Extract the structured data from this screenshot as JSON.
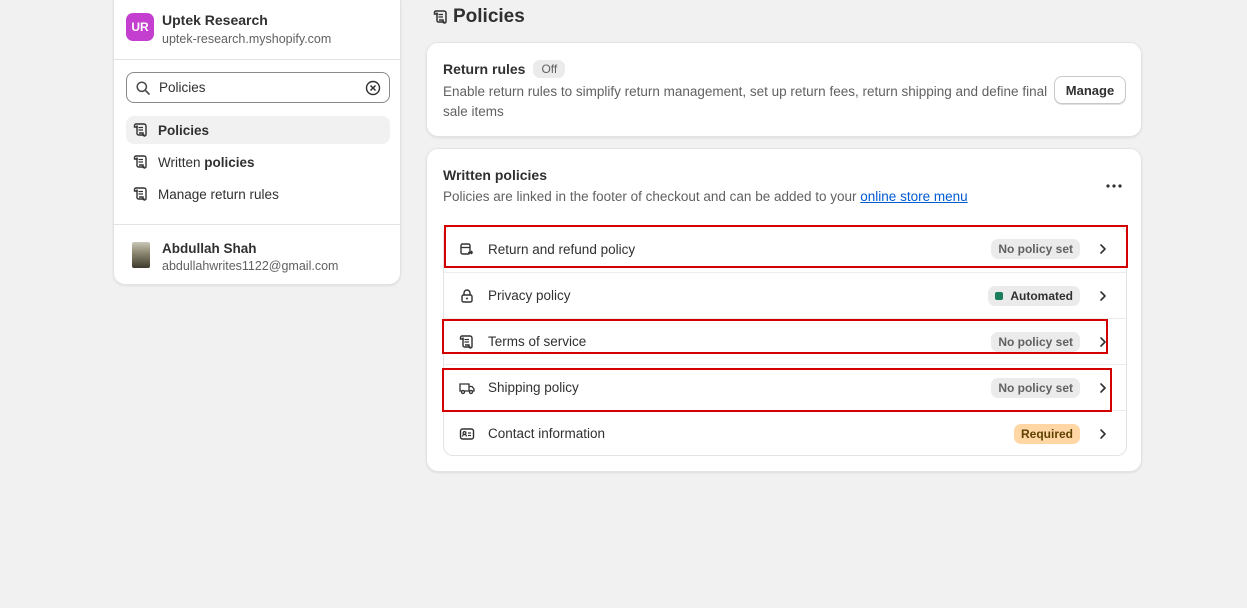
{
  "sidebar": {
    "store": {
      "initials": "UR",
      "name": "Uptek Research",
      "url": "uptek-research.myshopify.com",
      "avatar_color": "#c43ed0"
    },
    "search": {
      "value": "Policies",
      "placeholder": "Search"
    },
    "results": [
      {
        "label": "Policies",
        "active": true
      },
      {
        "label_plain": "Written ",
        "label_bold": "policies"
      },
      {
        "label": "Manage return rules"
      }
    ],
    "user": {
      "name": "Abdullah Shah",
      "email": "abdullahwrites1122@gmail.com"
    }
  },
  "page": {
    "title": "Policies"
  },
  "return_rules": {
    "title": "Return rules",
    "status": "Off",
    "description": "Enable return rules to simplify return management, set up return fees, return shipping and define final sale items",
    "button": "Manage"
  },
  "written_policies": {
    "title": "Written policies",
    "description": "Policies are linked in the footer of checkout and can be added to your ",
    "link_text": "online store menu",
    "rows": [
      {
        "label": "Return and refund policy",
        "badge": "No policy set",
        "icon": "return-box-icon"
      },
      {
        "label": "Privacy policy",
        "badge": "Automated",
        "icon": "lock-icon"
      },
      {
        "label": "Terms of service",
        "badge": "No policy set",
        "icon": "scroll-icon"
      },
      {
        "label": "Shipping policy",
        "badge": "No policy set",
        "icon": "truck-icon"
      },
      {
        "label": "Contact information",
        "badge": "Required",
        "icon": "contact-card-icon"
      }
    ]
  },
  "colors": {
    "link": "#005bd3",
    "automated_dot": "#1a7d5c",
    "required_badge": "#ffd6a4",
    "highlight": "#d40000"
  }
}
